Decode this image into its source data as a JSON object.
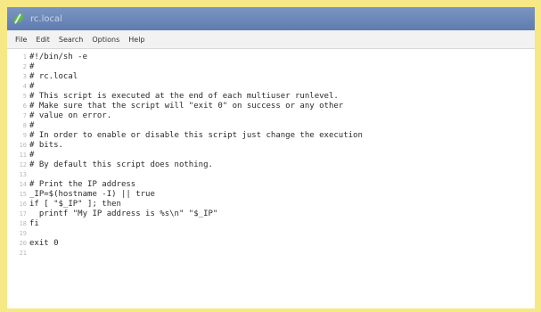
{
  "window": {
    "title": "rc.local"
  },
  "menu": [
    "File",
    "Edit",
    "Search",
    "Options",
    "Help"
  ],
  "lines": [
    {
      "n": "1",
      "text": "#!/bin/sh -e"
    },
    {
      "n": "2",
      "text": "#"
    },
    {
      "n": "3",
      "text": "# rc.local"
    },
    {
      "n": "4",
      "text": "#"
    },
    {
      "n": "5",
      "text": "# This script is executed at the end of each multiuser runlevel."
    },
    {
      "n": "6",
      "text": "# Make sure that the script will \"exit 0\" on success or any other"
    },
    {
      "n": "7",
      "text": "# value on error."
    },
    {
      "n": "8",
      "text": "#"
    },
    {
      "n": "9",
      "text": "# In order to enable or disable this script just change the execution"
    },
    {
      "n": "10",
      "text": "# bits."
    },
    {
      "n": "11",
      "text": "#"
    },
    {
      "n": "12",
      "text": "# By default this script does nothing."
    },
    {
      "n": "13",
      "text": ""
    },
    {
      "n": "14",
      "text": "# Print the IP address"
    },
    {
      "n": "15",
      "text": "_IP=$(hostname -I) || true"
    },
    {
      "n": "16",
      "text": "if [ \"$_IP\" ]; then"
    },
    {
      "n": "17",
      "text": "  printf \"My IP address is %s\\n\" \"$_IP\""
    },
    {
      "n": "18",
      "text": "fi"
    },
    {
      "n": "19",
      "text": ""
    },
    {
      "n": "20",
      "text": "exit 0"
    },
    {
      "n": "21",
      "text": ""
    }
  ]
}
